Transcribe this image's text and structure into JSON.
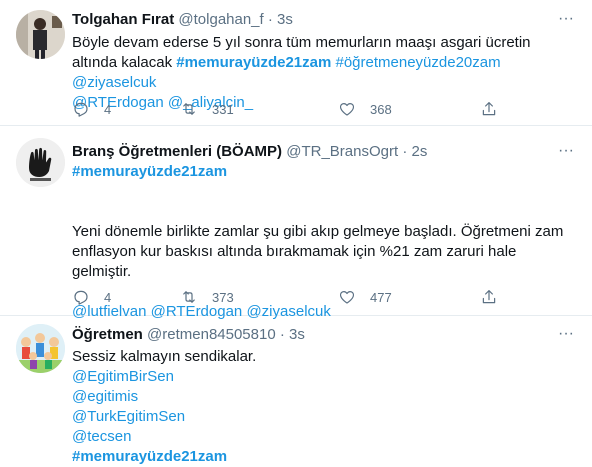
{
  "tweets": [
    {
      "name": "Tolgahan Fırat",
      "handle": "@tolgahan_f",
      "time": "3s",
      "text_plain": "Böyle devam ederse 5 yıl sonra tüm memurların maaşı asgari ücretin altında kalacak",
      "tags": [
        "#memurayüzde21zam",
        "#öğretmeneyüzde20zam"
      ],
      "mentions_line1": [
        "@ziyaselcuk"
      ],
      "mentions_line2": [
        "@RTErdogan",
        "@_aliyalcin_"
      ],
      "replies": "4",
      "retweets": "331",
      "likes": "368"
    },
    {
      "name": "Branş Öğretmenleri (BÖAMP)",
      "handle": "@TR_BransOgrt",
      "time": "2s",
      "hashtag": "#memurayüzde21zam",
      "body_line1": "Yeni dönemle birlikte zamlar şu gibi akıp gelmeye başladı. Öğretmeni zam",
      "body_line2": "enflasyon kur baskısı altında bırakmamak için %21 zam zaruri hale gelmiştir.",
      "mentions": [
        "@lutfielvan",
        "@RTErdogan",
        "@ziyaselcuk"
      ],
      "replies": "4",
      "retweets": "373",
      "likes": "477"
    },
    {
      "name": "Öğretmen",
      "handle": "@retmen84505810",
      "time": "3s",
      "body": "Sessiz kalmayın sendikalar.",
      "mentions": [
        "@EgitimBirSen",
        "@egitimis",
        "@TurkEgitimSen",
        "@tecsen"
      ],
      "hashtag": "#memurayüzde21zam"
    }
  ],
  "separator": "·",
  "more_glyph": "···",
  "colors": {
    "link": "#1b95e0",
    "meta": "#5b7083",
    "border": "#e6ecf0"
  }
}
